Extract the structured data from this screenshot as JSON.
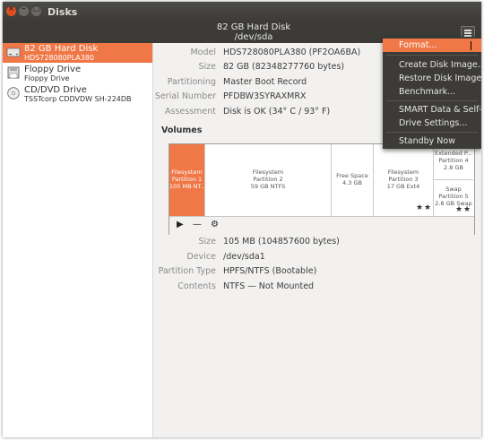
{
  "window": {
    "title": "Disks"
  },
  "header": {
    "disk_name": "82 GB Hard Disk",
    "disk_path": "/dev/sda"
  },
  "sidebar": {
    "items": [
      {
        "name": "82 GB Hard Disk",
        "sub": "HDS728080PLA380",
        "selected": true,
        "icon": "hard-disk-icon"
      },
      {
        "name": "Floppy Drive",
        "sub": "Floppy Drive",
        "selected": false,
        "icon": "floppy-icon"
      },
      {
        "name": "CD/DVD Drive",
        "sub": "TSSTcorp CDDVDW SH-224DB",
        "selected": false,
        "icon": "optical-disc-icon"
      }
    ]
  },
  "disk_props": [
    {
      "key": "Model",
      "value": "HDS728080PLA380 (PF2OA6BA)"
    },
    {
      "key": "Size",
      "value": "82 GB (82348277760 bytes)"
    },
    {
      "key": "Partitioning",
      "value": "Master Boot Record"
    },
    {
      "key": "Serial Number",
      "value": "PFDBW3SYRAXMRX"
    },
    {
      "key": "Assessment",
      "value": "Disk is OK (34° C / 93° F)"
    }
  ],
  "volumes": {
    "heading": "Volumes",
    "segments": [
      {
        "lines": [
          "Filesystem",
          "Partition 1",
          "105 MB NT..."
        ],
        "selected": true
      },
      {
        "lines": [
          "Filesystem",
          "Partition 2",
          "59 GB NTFS"
        ],
        "selected": false
      },
      {
        "lines": [
          "Free Space",
          "4.3 GB"
        ],
        "selected": false
      },
      {
        "lines": [
          "Filesystem",
          "Partition 3",
          "17 GB Ext4"
        ],
        "selected": false
      }
    ],
    "extended": {
      "lines": [
        "Extended P...",
        "Partition 4",
        "2.8 GB"
      ]
    },
    "swap": {
      "lines": [
        "Swap",
        "Partition 5",
        "2.8 GB Swap"
      ]
    },
    "toolbar": {
      "play": "▶",
      "minus": "—",
      "gear": "⚙"
    }
  },
  "partition_props": [
    {
      "key": "Size",
      "value": "105 MB (104857600 bytes)"
    },
    {
      "key": "Device",
      "value": "/dev/sda1"
    },
    {
      "key": "Partition Type",
      "value": "HPFS/NTFS (Bootable)"
    },
    {
      "key": "Contents",
      "value": "NTFS — Not Mounted"
    }
  ],
  "menu": {
    "items": [
      {
        "label": "Format...",
        "selected": true
      },
      {
        "label": "Create Disk Image...",
        "selected": false
      },
      {
        "label": "Restore Disk Image...",
        "selected": false
      },
      {
        "label": "Benchmark...",
        "selected": false
      },
      {
        "label": "SMART Data & Self-Tests...",
        "selected": false
      },
      {
        "label": "Drive Settings...",
        "selected": false
      },
      {
        "label": "Standby Now",
        "selected": false
      }
    ]
  },
  "colors": {
    "accent": "#f07746",
    "titlebar": "#3c3b37",
    "close": "#e04f1f"
  }
}
